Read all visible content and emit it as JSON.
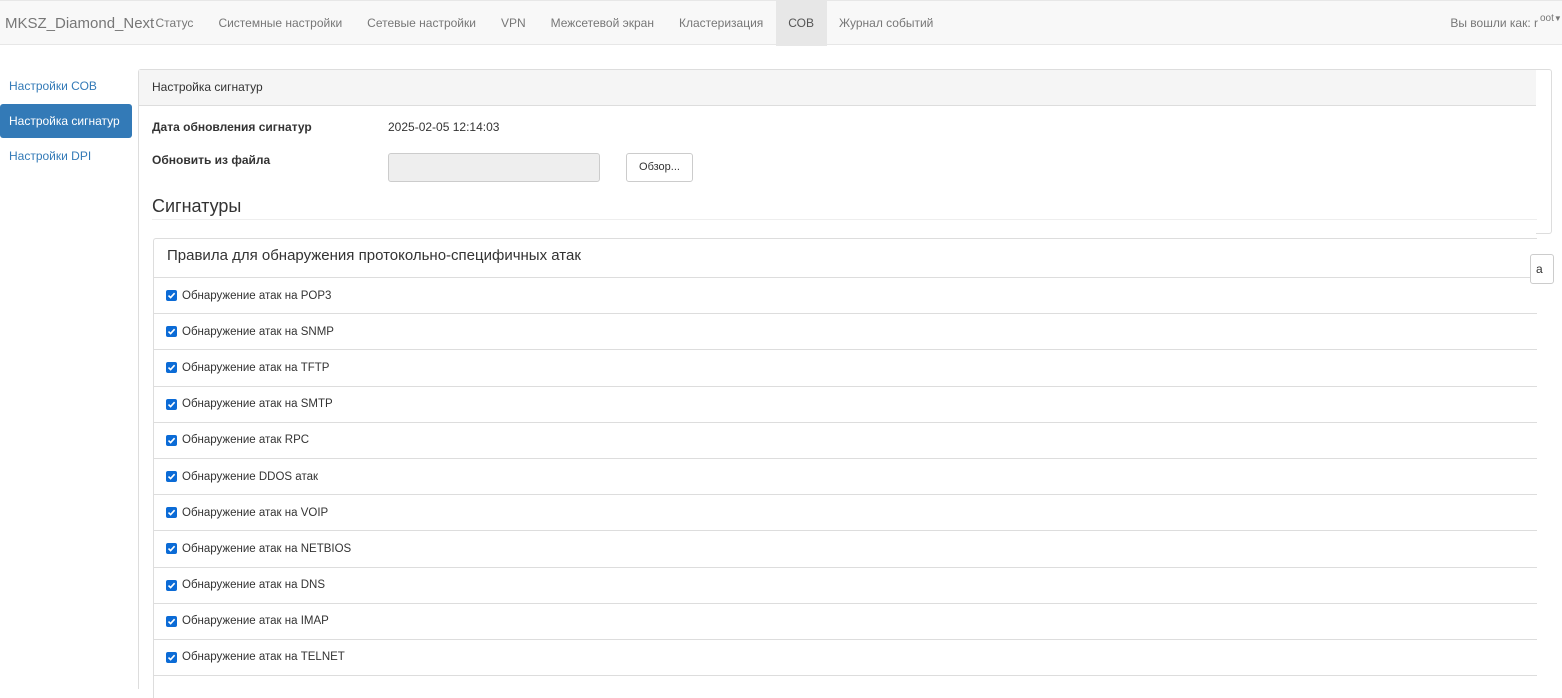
{
  "navbar": {
    "brand": "MKSZ_Diamond_Next",
    "items": [
      {
        "label": "Статус"
      },
      {
        "label": "Системные настройки"
      },
      {
        "label": "Сетевые настройки"
      },
      {
        "label": "VPN"
      },
      {
        "label": "Межсетевой экран"
      },
      {
        "label": "Кластеризация"
      },
      {
        "label": "СОВ"
      },
      {
        "label": "Журнал событий"
      }
    ],
    "active_item": "СОВ",
    "user_prefix": "Вы вошли как: r",
    "user_name": "oot"
  },
  "sidebar": {
    "items": [
      {
        "label": "Настройки СОВ"
      },
      {
        "label": "Настройка сигнатур"
      },
      {
        "label": "Настройки DPI"
      }
    ]
  },
  "panel": {
    "heading": "Настройка сигнатур",
    "update_date_label": "Дата обновления сигнатур",
    "update_date_value": "2025-02-05 12:14:03",
    "update_file_label": "Обновить из файла",
    "file_value": "",
    "browse_label": "Обзор...",
    "section_title": "Сигнатуры",
    "rules_heading": "Правила для обнаружения протокольно-специфичных атак",
    "rules": [
      {
        "label": "Обнаружение атак на POP3",
        "checked": true
      },
      {
        "label": "Обнаружение атак на SNMP",
        "checked": true
      },
      {
        "label": "Обнаружение атак на TFTP",
        "checked": true
      },
      {
        "label": "Обнаружение атак на SMTP",
        "checked": true
      },
      {
        "label": "Обнаружение атак RPC",
        "checked": true
      },
      {
        "label": "Обнаружение DDOS атак",
        "checked": true
      },
      {
        "label": "Обнаружение атак на VOIP",
        "checked": true
      },
      {
        "label": "Обнаружение атак на NETBIOS",
        "checked": true
      },
      {
        "label": "Обнаружение атак на DNS",
        "checked": true
      },
      {
        "label": "Обнаружение атак на IMAP",
        "checked": true
      },
      {
        "label": "Обнаружение атак на TELNET",
        "checked": true
      }
    ]
  },
  "right_fragment": {
    "button_label": "а"
  },
  "colors": {
    "accent": "#337ab7",
    "checkbox": "#0b6bd6",
    "navbar_bg": "#f8f8f8"
  }
}
